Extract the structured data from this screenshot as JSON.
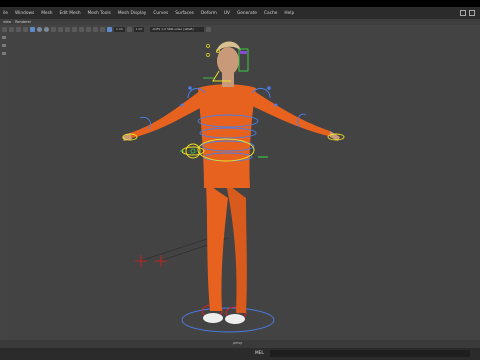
{
  "window": {
    "menus": [
      "ile",
      "Windows",
      "Mesh",
      "Edit Mesh",
      "Mesh Tools",
      "Mesh Display",
      "Curves",
      "Surfaces",
      "Deform",
      "UV",
      "Generate",
      "Cache",
      "Help"
    ]
  },
  "panel_menu": {
    "items": [
      "view",
      "Renderer"
    ]
  },
  "toolbar": {
    "field_a": "0.00",
    "field_b": "1.00",
    "color_space": "ACES 1.0 SDR-video (sRGB)"
  },
  "viewport": {
    "camera_label": "persp"
  },
  "command_line": {
    "label": "MEL"
  },
  "colors": {
    "background": "#434343",
    "jumpsuit": "#e8621f",
    "control_blue": "#4a7ee8",
    "control_yellow": "#f0e020",
    "control_green": "#38d840",
    "control_red": "#e02020"
  }
}
